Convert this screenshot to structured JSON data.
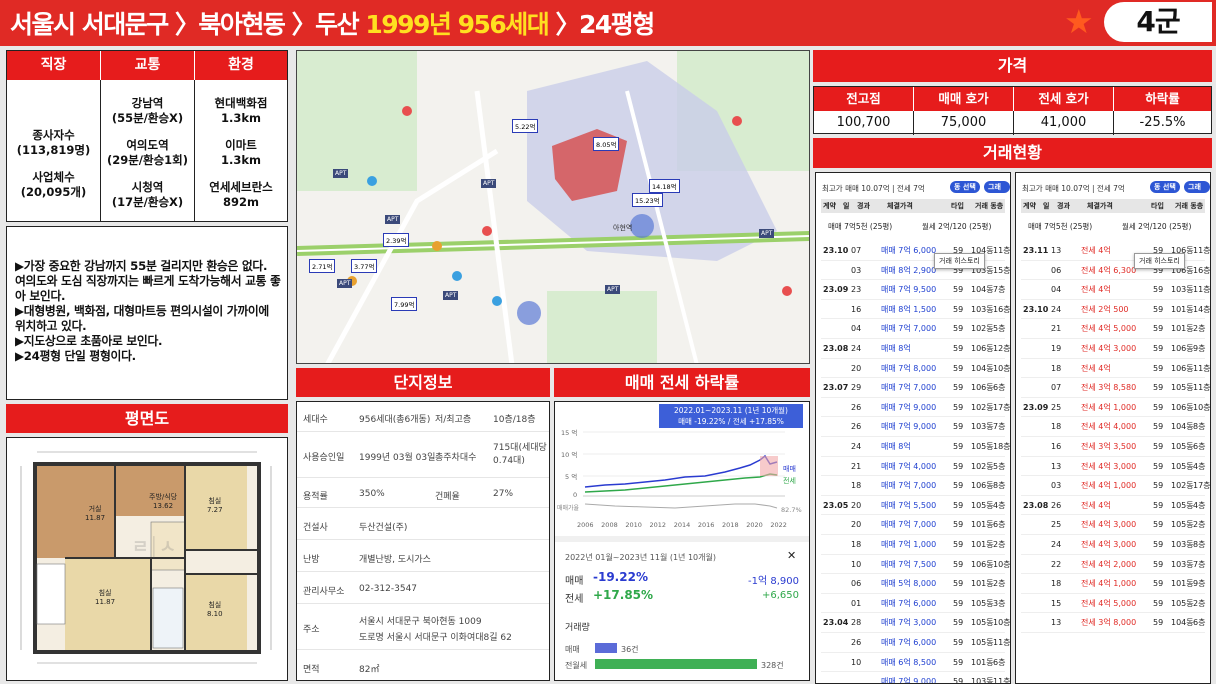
{
  "header": {
    "p1": "서울시 서대문구 〉북아현동 〉두산 ",
    "p2": "1999년 956세대",
    "p3": " 〉24평형",
    "star": "★",
    "group": "4군"
  },
  "categories": {
    "h": [
      "직장",
      "교통",
      "환경"
    ],
    "work": [
      "종사자수",
      "(113,819명)",
      "사업체수",
      "(20,095개)"
    ],
    "traffic": [
      "강남역",
      "(55분/환승X)",
      "여의도역",
      "(29분/환승1회)",
      "시청역",
      "(17분/환승X)"
    ],
    "env": [
      "현대백화점",
      "1.3km",
      "이마트",
      "1.3km",
      "연세세브란스",
      "892m"
    ]
  },
  "note": [
    "▶가장 중요한 강남까지 55분 걸리지만 환승은 없다. 여의도와 도심 직장까지는 빠르게 도착가능해서 교통 좋아 보인다.",
    "▶대형병원, 백화점, 대형마트등 편의시설이 가까이에 위치하고 있다.",
    "▶지도상으로 초품아로 보인다.",
    "▶24평형 단일 평형이다."
  ],
  "floorplan": {
    "title": "평면도",
    "room1": "거실",
    "room1a": "11.87",
    "room2": "주방/식당",
    "room2a": "13.62",
    "room3": "침실",
    "room3a": "7.27",
    "room4": "침실",
    "room4a": "11.87",
    "room5": "침실",
    "room5a": "8.10",
    "wm": "ㄹ│ㅅ"
  },
  "map": {
    "labels": [
      "APT",
      "APT",
      "APT",
      "APT",
      "APT",
      "APT",
      "APT"
    ],
    "metro": "아현역",
    "tags": [
      "2.71억",
      "3.77억",
      "2.39억",
      "5.22억",
      "8.05억",
      "14.18억",
      "7.99억",
      "15.23억"
    ]
  },
  "complex": {
    "title": "단지정보",
    "rows": [
      [
        "세대수",
        "956세대(총6개동)",
        "저/최고층",
        "10층/18층"
      ],
      [
        "사용승인일",
        "1999년 03월 03일",
        "총주차대수",
        "715대(세대당 0.74대)"
      ],
      [
        "용적률",
        "350%",
        "건폐율",
        "27%"
      ],
      [
        "건설사",
        "두산건설(주)",
        "",
        ""
      ],
      [
        "난방",
        "개별난방, 도시가스",
        "",
        ""
      ],
      [
        "관리사무소",
        "02-312-3547",
        "",
        ""
      ],
      [
        "주소",
        "서울시 서대문구 북아현동 1009",
        "",
        ""
      ],
      [
        "",
        "도로명  서울시 서대문구 이화여대8길 62",
        "",
        ""
      ],
      [
        "면적",
        "82㎡",
        "",
        ""
      ]
    ]
  },
  "drop": {
    "title": "매매 전세 하락률",
    "legend1": "2022.01~2023.11 (1년 10개월)",
    "legend2": "매매 -19.22% / 전세 +17.85%",
    "y": [
      "15 억",
      "10 억",
      "5 억",
      "0"
    ],
    "x": [
      "2006",
      "2008",
      "2010",
      "2012",
      "2014",
      "2016",
      "2018",
      "2020",
      "2022"
    ],
    "s1": "매매",
    "s2": "전세",
    "s3": "매매가율",
    "pct": "82.7%",
    "period": "2022년 01월~2023년 11월 (1년 10개월)",
    "mm": "매매",
    "mmp": "-19.22%",
    "mmv": "-1억 8,900",
    "js": "전세",
    "jsp": "+17.85%",
    "jsv": "+6,650",
    "vol": "거래량",
    "vm": "매매",
    "vmc": "36건",
    "vj": "전월세",
    "vjc": "328건",
    "close": "✕"
  },
  "price": {
    "title": "가격",
    "h": [
      "전고점",
      "매매 호가",
      "전세 호가",
      "하락률"
    ],
    "v": [
      "100,700",
      "75,000",
      "41,000",
      "-25.5%"
    ]
  },
  "trade": {
    "title": "거래현황",
    "left": {
      "top": "최고가 매매 10.07억 | 전세 7억",
      "b1": "동 선택",
      "b2": "그래프",
      "th": [
        "계약",
        "일",
        "경과",
        "체결가격",
        "타입",
        "거래 동층"
      ],
      "sel1": "매매 7억5천 (25평)",
      "sel2": "월세 2억/120 (25평)",
      "tip": "거래 히스토리",
      "rows": [
        [
          "23.10",
          "07",
          "매매 7억 6,000",
          "59",
          "104동",
          "11층"
        ],
        [
          "",
          "03",
          "매매 8억 2,900",
          "59",
          "103동",
          "15층"
        ],
        [
          "23.09",
          "23",
          "매매 7억 9,500",
          "59",
          "104동",
          "7층"
        ],
        [
          "",
          "16",
          "매매 8억 1,500",
          "59",
          "103동",
          "16층"
        ],
        [
          "",
          "04",
          "매매 7억 7,000",
          "59",
          "102동",
          "5층"
        ],
        [
          "23.08",
          "24",
          "매매 8억",
          "59",
          "106동",
          "12층"
        ],
        [
          "",
          "20",
          "매매 7억 8,000",
          "59",
          "104동",
          "10층"
        ],
        [
          "23.07",
          "29",
          "매매 7억 7,000",
          "59",
          "106동",
          "6층"
        ],
        [
          "",
          "26",
          "매매 7억 9,000",
          "59",
          "102동",
          "17층"
        ],
        [
          "",
          "26",
          "매매 7억 9,000",
          "59",
          "103동",
          "7층"
        ],
        [
          "",
          "24",
          "매매 8억",
          "59",
          "105동",
          "18층"
        ],
        [
          "",
          "21",
          "매매 7억 4,000",
          "59",
          "102동",
          "5층"
        ],
        [
          "",
          "18",
          "매매 7억 7,000",
          "59",
          "106동",
          "8층"
        ],
        [
          "23.05",
          "20",
          "매매 7억 5,500",
          "59",
          "105동",
          "4층"
        ],
        [
          "",
          "20",
          "매매 7억 7,000",
          "59",
          "101동",
          "6층"
        ],
        [
          "",
          "18",
          "매매 7억 1,000",
          "59",
          "101동",
          "2층"
        ],
        [
          "",
          "10",
          "매매 7억 7,500",
          "59",
          "106동",
          "10층"
        ],
        [
          "",
          "06",
          "매매 5억 8,000",
          "59",
          "101동",
          "2층"
        ],
        [
          "",
          "01",
          "매매 7억 6,000",
          "59",
          "105동",
          "3층"
        ],
        [
          "23.04",
          "28",
          "매매 7억 3,000",
          "59",
          "105동",
          "10층"
        ],
        [
          "",
          "26",
          "매매 7억 6,000",
          "59",
          "105동",
          "11층"
        ],
        [
          "",
          "10",
          "매매 6억 8,500",
          "59",
          "101동",
          "6층"
        ],
        [
          "",
          "",
          "매매 7억 9,000",
          "59",
          "103동",
          "11층"
        ]
      ]
    },
    "right": {
      "top": "최고가 매매 10.07억 | 전세 7억",
      "b1": "동 선택",
      "b2": "그래프",
      "th": [
        "계약",
        "일",
        "경과",
        "체결가격",
        "타입",
        "거래 동층"
      ],
      "sel1": "매매 7억5천 (25평)",
      "sel2": "월세 2억/120 (25평)",
      "tip": "거래 히스토리",
      "rows": [
        [
          "23.11",
          "13",
          "전세 4억",
          "59",
          "106동",
          "11층"
        ],
        [
          "",
          "06",
          "전세 4억 6,300",
          "59",
          "106동",
          "16층"
        ],
        [
          "",
          "04",
          "전세 4억",
          "59",
          "103동",
          "11층"
        ],
        [
          "23.10",
          "24",
          "전세 2억 500",
          "59",
          "101동",
          "14층"
        ],
        [
          "",
          "21",
          "전세 4억 5,000",
          "59",
          "101동",
          "2층"
        ],
        [
          "",
          "19",
          "전세 4억 3,000",
          "59",
          "106동",
          "9층"
        ],
        [
          "",
          "18",
          "전세 4억",
          "59",
          "106동",
          "11층"
        ],
        [
          "",
          "07",
          "전세 3억 8,580",
          "59",
          "105동",
          "11층"
        ],
        [
          "23.09",
          "25",
          "전세 4억 1,000",
          "59",
          "106동",
          "10층"
        ],
        [
          "",
          "18",
          "전세 4억 4,000",
          "59",
          "104동",
          "8층"
        ],
        [
          "",
          "16",
          "전세 3억 3,500",
          "59",
          "105동",
          "6층"
        ],
        [
          "",
          "13",
          "전세 4억 3,000",
          "59",
          "105동",
          "4층"
        ],
        [
          "",
          "03",
          "전세 4억 1,000",
          "59",
          "102동",
          "17층"
        ],
        [
          "23.08",
          "26",
          "전세 4억",
          "59",
          "105동",
          "4층"
        ],
        [
          "",
          "25",
          "전세 4억 3,000",
          "59",
          "105동",
          "2층"
        ],
        [
          "",
          "24",
          "전세 4억 3,000",
          "59",
          "103동",
          "8층"
        ],
        [
          "",
          "22",
          "전세 4억 2,000",
          "59",
          "103동",
          "7층"
        ],
        [
          "",
          "18",
          "전세 4억 1,000",
          "59",
          "101동",
          "9층"
        ],
        [
          "",
          "15",
          "전세 4억 5,000",
          "59",
          "105동",
          "2층"
        ],
        [
          "",
          "13",
          "전세 3억 8,000",
          "59",
          "104동",
          "6층"
        ]
      ]
    }
  }
}
